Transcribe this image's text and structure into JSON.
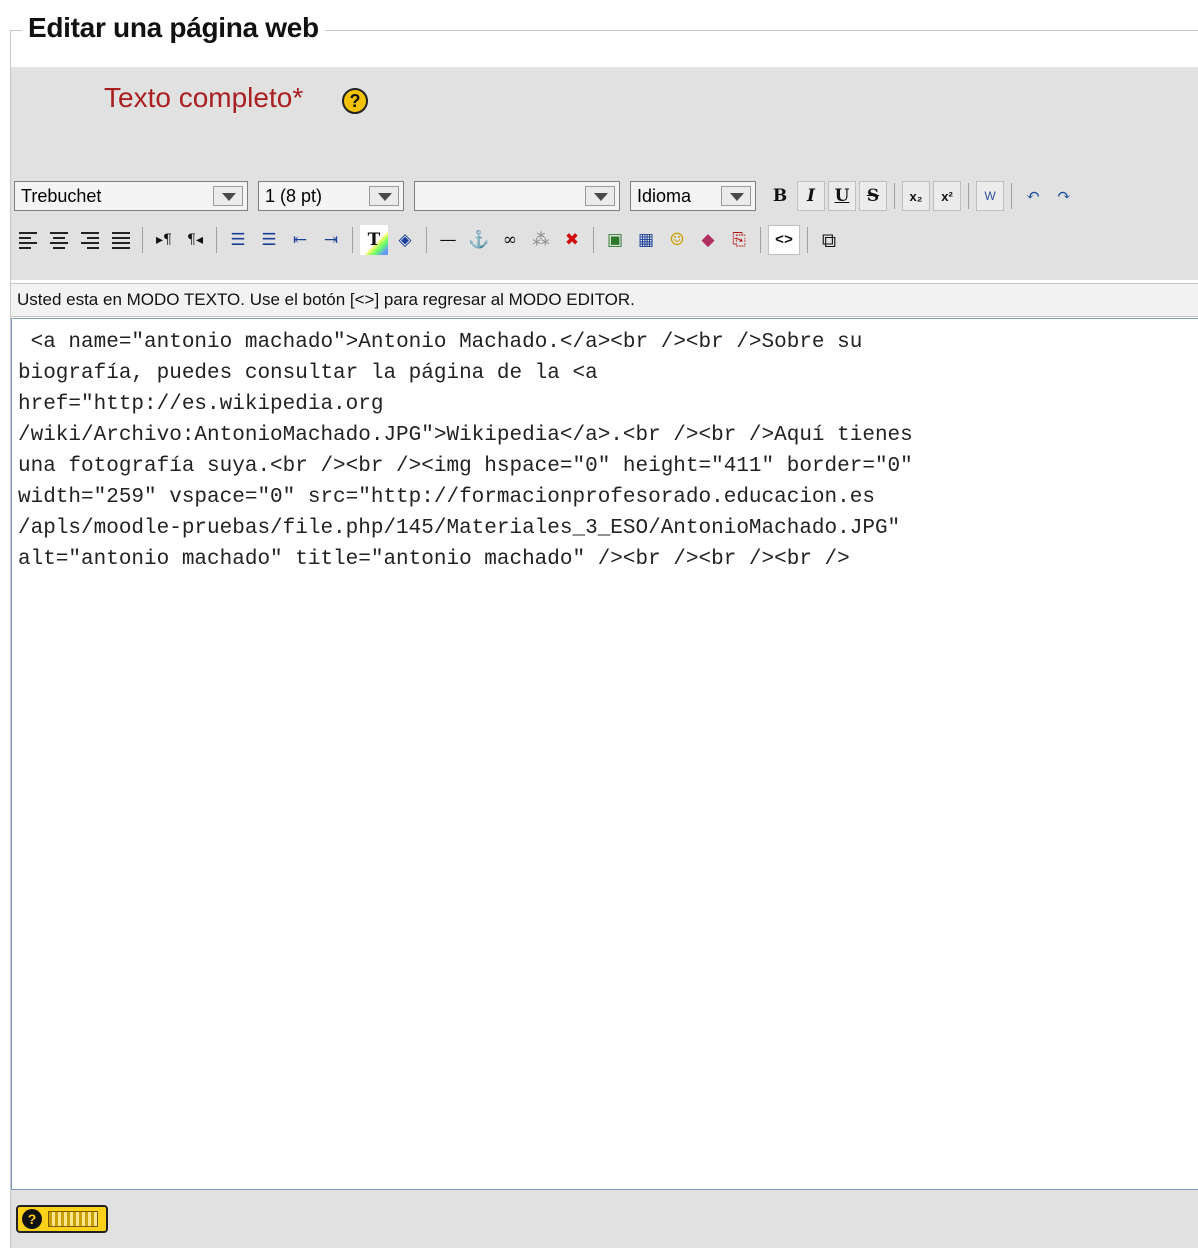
{
  "page": {
    "legend": "Editar una página web",
    "field_label": "Texto completo",
    "required_mark": "*",
    "help_glyph": "?"
  },
  "toolbar": {
    "font_family": "Trebuchet",
    "font_size": "1 (8 pt)",
    "format": "",
    "language": "Idioma",
    "row1_buttons": [
      {
        "name": "bold-button",
        "glyph": "B"
      },
      {
        "name": "italic-button",
        "glyph": "I"
      },
      {
        "name": "underline-button",
        "glyph": "U"
      },
      {
        "name": "strikethrough-button",
        "glyph": "S"
      },
      {
        "name": "subscript-button",
        "glyph": "x₂"
      },
      {
        "name": "superscript-button",
        "glyph": "x²"
      },
      {
        "name": "paste-word-button",
        "glyph": "W"
      },
      {
        "name": "undo-button",
        "glyph": "↶"
      },
      {
        "name": "redo-button",
        "glyph": "↷"
      }
    ],
    "row2_buttons": [
      {
        "name": "align-left-icon"
      },
      {
        "name": "align-center-icon"
      },
      {
        "name": "align-right-icon"
      },
      {
        "name": "justify-icon"
      },
      {
        "name": "ltr-icon",
        "glyph": "▸¶"
      },
      {
        "name": "rtl-icon",
        "glyph": "¶◂"
      },
      {
        "name": "ordered-list-icon",
        "glyph": "☰"
      },
      {
        "name": "unordered-list-icon",
        "glyph": "☰"
      },
      {
        "name": "outdent-icon",
        "glyph": "⇤"
      },
      {
        "name": "indent-icon",
        "glyph": "⇥"
      },
      {
        "name": "text-color-icon",
        "glyph": "T"
      },
      {
        "name": "background-color-icon",
        "glyph": "◈"
      },
      {
        "name": "horizontal-rule-icon",
        "glyph": "—"
      },
      {
        "name": "anchor-icon",
        "glyph": "⚓"
      },
      {
        "name": "link-icon",
        "glyph": "∞"
      },
      {
        "name": "unlink-icon",
        "glyph": "⁂"
      },
      {
        "name": "nolink-icon",
        "glyph": "✖"
      },
      {
        "name": "insert-image-icon",
        "glyph": "▣"
      },
      {
        "name": "insert-table-icon",
        "glyph": "▦"
      },
      {
        "name": "smiley-icon",
        "glyph": "☺"
      },
      {
        "name": "special-char-icon",
        "glyph": "◆"
      },
      {
        "name": "search-replace-icon",
        "glyph": "⎘"
      },
      {
        "name": "toggle-html-button",
        "glyph": "<>"
      },
      {
        "name": "fullscreen-icon",
        "glyph": "⧉"
      }
    ]
  },
  "status": {
    "text": "Usted esta en MODO TEXTO. Use el botón [<>] para regresar al MODO EDITOR."
  },
  "editor": {
    "content": " <a name=\"antonio machado\">Antonio Machado.</a><br /><br />Sobre su\nbiografía, puedes consultar la página de la <a\nhref=\"http://es.wikipedia.org\n/wiki/Archivo:AntonioMachado.JPG\">Wikipedia</a>.<br /><br />Aquí tienes\nuna fotografía suya.<br /><br /><img hspace=\"0\" height=\"411\" border=\"0\"\nwidth=\"259\" vspace=\"0\" src=\"http://formacionprofesorado.educacion.es\n/apls/moodle-pruebas/file.php/145/Materiales_3_ESO/AntonioMachado.JPG\"\nalt=\"antonio machado\" title=\"antonio machado\" /><br /><br /><br />"
  },
  "footer": {
    "keyboard_help_glyph": "?"
  }
}
